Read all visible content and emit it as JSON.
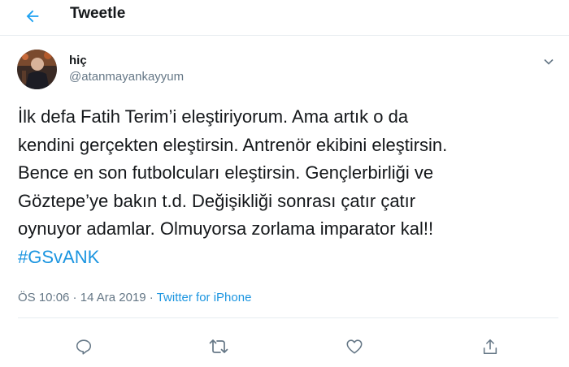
{
  "header": {
    "title": "Tweetle",
    "back_icon": "arrow-left-icon"
  },
  "tweet": {
    "author": {
      "name": "hiç",
      "handle": "@atanmayankayyum"
    },
    "text_lines": [
      "İlk defa Fatih Terim’i eleştiriyorum. Ama artık o da",
      "kendini gerçekten eleştirsin. Antrenör ekibini eleştirsin.",
      "Bence en son futbolcuları eleştirsin. Gençlerbirliği ve",
      "Göztepe’ye bakın t.d. Değişikliği sonrası çatır çatır",
      "oynuyor adamlar. Olmuyorsa zorlama imparator kal!!"
    ],
    "hashtag": "#GSvANK",
    "time": "ÖS 10:06",
    "separator": " · ",
    "date": "14 Ara 2019",
    "source": "Twitter for iPhone"
  },
  "actions": [
    "reply-icon",
    "retweet-icon",
    "like-icon",
    "share-icon"
  ],
  "colors": {
    "accent": "#1b95e0",
    "muted": "#657786",
    "text": "#14171a",
    "border": "#e6ecf0"
  }
}
